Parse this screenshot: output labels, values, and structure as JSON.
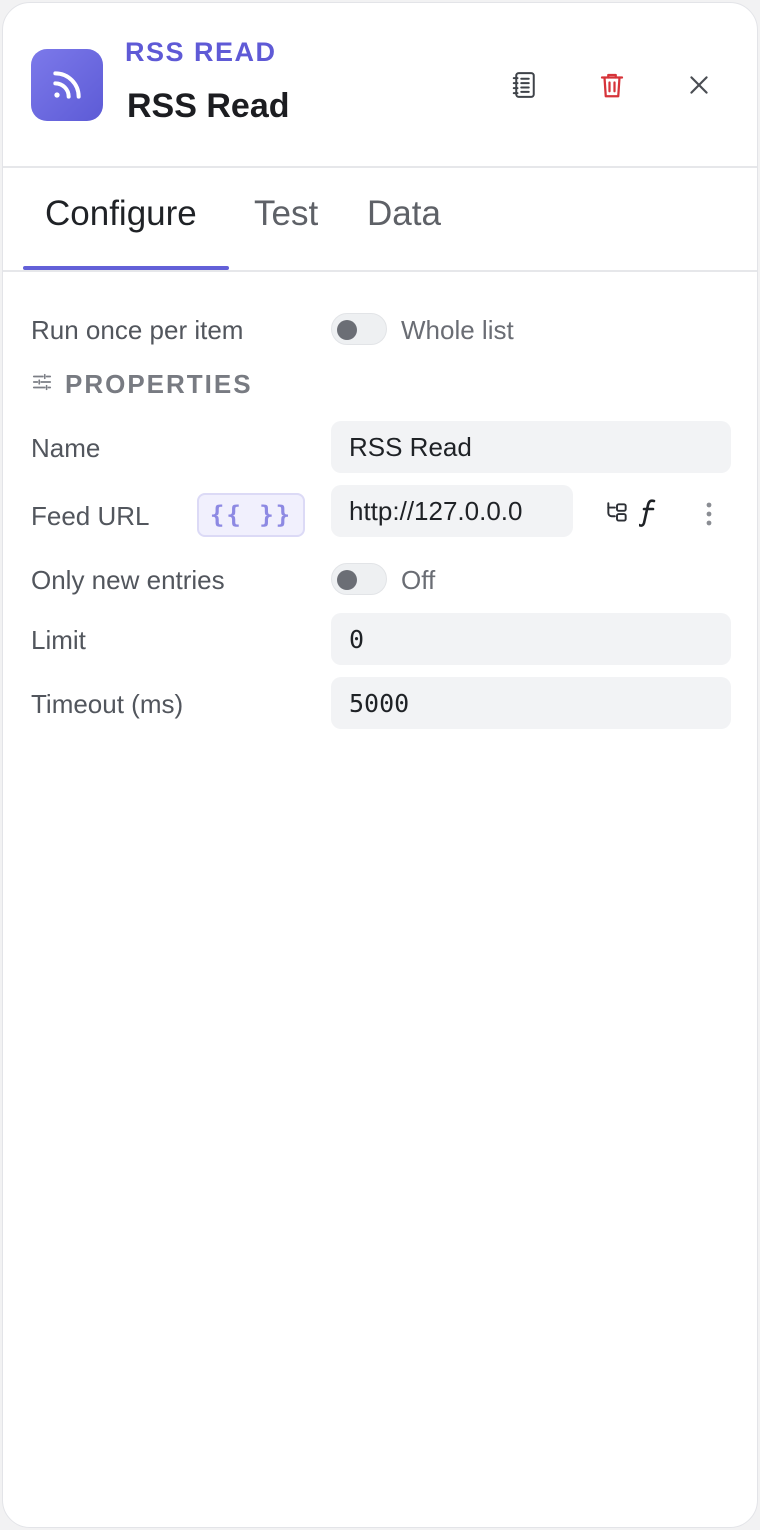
{
  "header": {
    "node_type": "RSS READ",
    "node_name": "RSS Read",
    "icons": {
      "node": "rss-icon",
      "docs": "notebook-icon",
      "delete": "trash-icon",
      "close": "close-icon"
    }
  },
  "tabs": [
    {
      "label": "Configure",
      "active": true
    },
    {
      "label": "Test",
      "active": false
    },
    {
      "label": "Data",
      "active": false
    }
  ],
  "run_mode": {
    "label": "Run once per item",
    "toggle_text": "Whole list",
    "on": false
  },
  "properties": {
    "title": "PROPERTIES",
    "icon": "sliders-icon",
    "name": {
      "label": "Name",
      "value": "RSS Read"
    },
    "feed_url": {
      "label": "Feed URL",
      "expression_badge": "{{ }}",
      "value": "http://127.0.0.0",
      "icons": [
        "schema-tree-icon",
        "function-icon",
        "more-vertical-icon"
      ]
    },
    "only_new_entries": {
      "label": "Only new entries",
      "toggle_text": "Off",
      "on": false
    },
    "limit": {
      "label": "Limit",
      "value": "0"
    },
    "timeout": {
      "label": "Timeout (ms)",
      "value": "5000"
    }
  },
  "colors": {
    "accent": "#6360d8",
    "delete": "#d6343a",
    "icon_bg": "#6a67df"
  }
}
